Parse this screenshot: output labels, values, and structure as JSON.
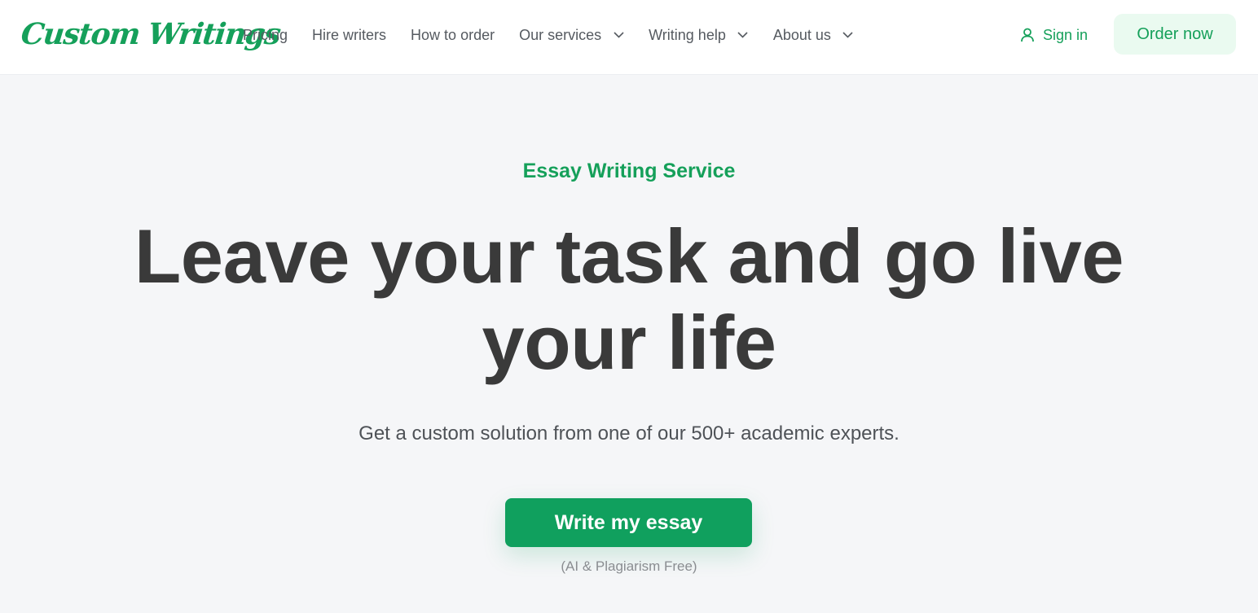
{
  "header": {
    "logo_text": "Custom Writings",
    "nav": [
      {
        "label": "Pricing",
        "has_dropdown": false
      },
      {
        "label": "Hire writers",
        "has_dropdown": false
      },
      {
        "label": "How to order",
        "has_dropdown": false
      },
      {
        "label": "Our services",
        "has_dropdown": true
      },
      {
        "label": "Writing help",
        "has_dropdown": true
      },
      {
        "label": "About us",
        "has_dropdown": true
      }
    ],
    "sign_in_label": "Sign in",
    "sign_in_icon": "user-icon",
    "order_button_label": "Order now"
  },
  "hero": {
    "eyebrow": "Essay Writing Service",
    "headline": "Leave your task and go live your life",
    "subtitle": "Get a custom solution from one of our 500+ academic experts.",
    "cta_label": "Write my essay",
    "cta_note": "(AI & Plagiarism Free)"
  },
  "colors": {
    "brand_green": "#15a05a",
    "cta_green": "#10a05e",
    "order_button_bg": "#eafaf0",
    "hero_bg": "#f5f6f8",
    "headline_text": "#3a3a3a",
    "nav_text": "#555a60"
  }
}
